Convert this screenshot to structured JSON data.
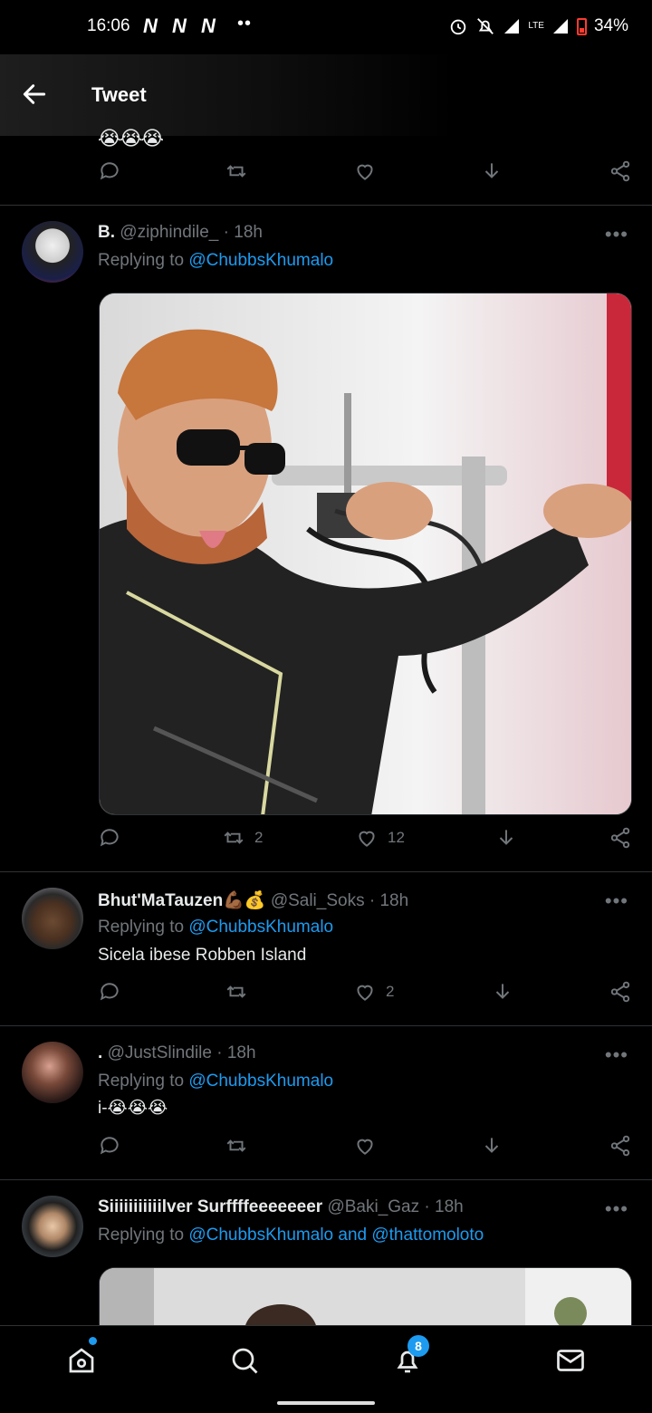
{
  "status_bar": {
    "time": "16:06",
    "signal_n": "N",
    "dots": "••",
    "lte": "LTE",
    "battery": "34%"
  },
  "header": {
    "title": "Tweet"
  },
  "prev_tweet": {
    "emoji_tail": "😭😭😭"
  },
  "tweets": [
    {
      "name": "B.",
      "handle": "@ziphindile_",
      "time": "· 18h",
      "replying_prefix": "Replying to",
      "replying_to": "@ChubbsKhumalo",
      "text": "",
      "retweets": "2",
      "likes": "12",
      "replies": ""
    },
    {
      "name": "Bhut'MaTauzen💪🏾💰",
      "handle": "@Sali_Soks",
      "time": "· 18h",
      "replying_prefix": "Replying to",
      "replying_to": "@ChubbsKhumalo",
      "text": "Sicela ibese Robben Island",
      "retweets": "",
      "likes": "2",
      "replies": ""
    },
    {
      "name": ".",
      "handle": "@JustSlindile",
      "time": "· 18h",
      "replying_prefix": "Replying to",
      "replying_to": "@ChubbsKhumalo",
      "text": "i-😭😭😭",
      "retweets": "",
      "likes": "",
      "replies": ""
    },
    {
      "name": "Siiiiiiiiiiilver Surffffeeeeeeer",
      "handle": "@Baki_Gaz",
      "time": "· 18h",
      "replying_prefix": "Replying to",
      "replying_to": "@ChubbsKhumalo and @thattomoloto",
      "text": ""
    }
  ],
  "more_label": "•••",
  "nav": {
    "notifications_badge": "8"
  },
  "colors": {
    "accent": "#1d9bf0",
    "muted": "#71767b",
    "divider": "#2f3336"
  }
}
